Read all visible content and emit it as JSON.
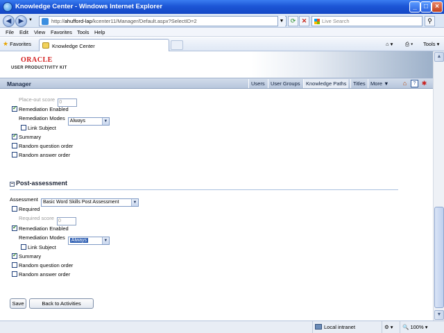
{
  "window": {
    "title": "Knowledge Center - Windows Internet Explorer",
    "min_glyph": "_",
    "max_glyph": "□",
    "close_glyph": "×"
  },
  "address": {
    "url_prefix": "http://",
    "url_host": "ahufford-lap",
    "url_path": "/kcenter11/Manager/Default.aspx?SelectID=2",
    "search_placeholder": "Live Search"
  },
  "menu": [
    "File",
    "Edit",
    "View",
    "Favorites",
    "Tools",
    "Help"
  ],
  "favbar": {
    "favorites_label": "Favorites",
    "tab_label": "Knowledge Center",
    "tools_label": "Tools"
  },
  "header": {
    "logo_word": "ORACLE",
    "logo_sub": "USER PRODUCTIVITY KIT"
  },
  "manager": {
    "title": "Manager",
    "tabs": [
      "Users",
      "User Groups",
      "Knowledge Paths",
      "Titles",
      "More ▼"
    ],
    "active_tab": "Knowledge Paths"
  },
  "pre": {
    "placeout_label": "Place-out score",
    "placeout_value": "0",
    "remediation_label": "Remediation Enabled",
    "modes_label": "Remediation Modes",
    "modes_value": "Always",
    "link_subject_label": "Link Subject",
    "summary_label": "Summary",
    "random_q_label": "Random question order",
    "random_a_label": "Random answer order"
  },
  "post": {
    "title": "Post-assessment",
    "assessment_label": "Assessment",
    "assessment_value": "Basic Word Skills Post Assessment",
    "required_label": "Required",
    "required_score_label": "Required score",
    "required_score_value": "0",
    "remediation_label": "Remediation Enabled",
    "modes_label": "Remediation Modes",
    "modes_value": "Always",
    "link_subject_label": "Link Subject",
    "summary_label": "Summary",
    "random_q_label": "Random question order",
    "random_a_label": "Random answer order"
  },
  "buttons": {
    "save": "Save",
    "back": "Back to Activities"
  },
  "status": {
    "zone": "Local intranet",
    "zoom": "100%"
  }
}
